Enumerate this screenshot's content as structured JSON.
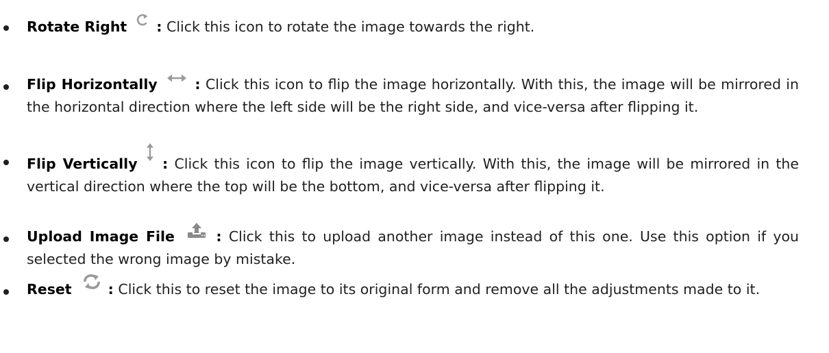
{
  "items": [
    {
      "title": "Rotate Right",
      "icon": "rotate-right-icon",
      "colon": ":",
      "text": " Click this icon to rotate the image towards the right."
    },
    {
      "title": "Flip Horizontally",
      "icon": "flip-horizontal-icon",
      "colon": ":",
      "text": " Click this icon to flip the image horizontally. With this, the image will be mirrored in the horizontal direction where the left side will be the right side, and vice-versa after flipping it."
    },
    {
      "title": "Flip Vertically",
      "icon": "flip-vertical-icon",
      "colon": ":",
      "text": " Click this icon to flip the image vertically. With this, the image will be mirrored in the vertical direction where the top will be the bottom, and vice-versa after flipping it."
    },
    {
      "title": "Upload Image File",
      "icon": "upload-icon",
      "colon": ":",
      "text": " Click this to upload another image instead of this one. Use this option if you selected the wrong image by mistake."
    },
    {
      "title": "Reset",
      "icon": "reset-icon",
      "colon": ":",
      "text": " Click this to reset the image to its original form and remove all the adjustments made to it."
    }
  ],
  "colors": {
    "text": "#1f1f1f",
    "icon": "#9a9a9a"
  }
}
